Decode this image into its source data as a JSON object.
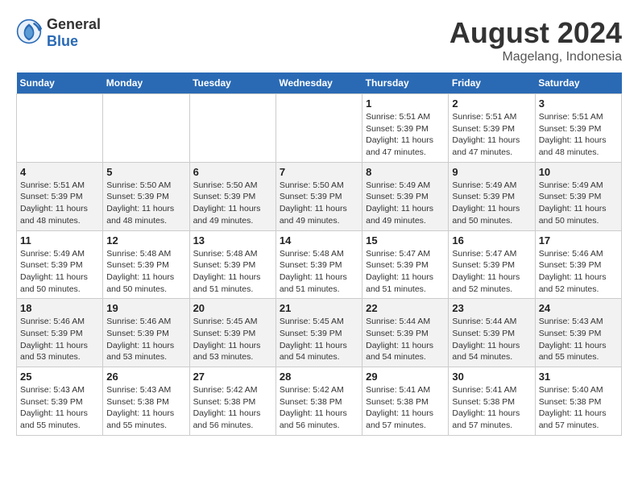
{
  "header": {
    "logo_general": "General",
    "logo_blue": "Blue",
    "month_year": "August 2024",
    "location": "Magelang, Indonesia"
  },
  "days_of_week": [
    "Sunday",
    "Monday",
    "Tuesday",
    "Wednesday",
    "Thursday",
    "Friday",
    "Saturday"
  ],
  "weeks": [
    {
      "days": [
        {
          "num": "",
          "sunrise": "",
          "sunset": "",
          "daylight": ""
        },
        {
          "num": "",
          "sunrise": "",
          "sunset": "",
          "daylight": ""
        },
        {
          "num": "",
          "sunrise": "",
          "sunset": "",
          "daylight": ""
        },
        {
          "num": "",
          "sunrise": "",
          "sunset": "",
          "daylight": ""
        },
        {
          "num": "1",
          "sunrise": "Sunrise: 5:51 AM",
          "sunset": "Sunset: 5:39 PM",
          "daylight": "Daylight: 11 hours and 47 minutes."
        },
        {
          "num": "2",
          "sunrise": "Sunrise: 5:51 AM",
          "sunset": "Sunset: 5:39 PM",
          "daylight": "Daylight: 11 hours and 47 minutes."
        },
        {
          "num": "3",
          "sunrise": "Sunrise: 5:51 AM",
          "sunset": "Sunset: 5:39 PM",
          "daylight": "Daylight: 11 hours and 48 minutes."
        }
      ]
    },
    {
      "days": [
        {
          "num": "4",
          "sunrise": "Sunrise: 5:51 AM",
          "sunset": "Sunset: 5:39 PM",
          "daylight": "Daylight: 11 hours and 48 minutes."
        },
        {
          "num": "5",
          "sunrise": "Sunrise: 5:50 AM",
          "sunset": "Sunset: 5:39 PM",
          "daylight": "Daylight: 11 hours and 48 minutes."
        },
        {
          "num": "6",
          "sunrise": "Sunrise: 5:50 AM",
          "sunset": "Sunset: 5:39 PM",
          "daylight": "Daylight: 11 hours and 49 minutes."
        },
        {
          "num": "7",
          "sunrise": "Sunrise: 5:50 AM",
          "sunset": "Sunset: 5:39 PM",
          "daylight": "Daylight: 11 hours and 49 minutes."
        },
        {
          "num": "8",
          "sunrise": "Sunrise: 5:49 AM",
          "sunset": "Sunset: 5:39 PM",
          "daylight": "Daylight: 11 hours and 49 minutes."
        },
        {
          "num": "9",
          "sunrise": "Sunrise: 5:49 AM",
          "sunset": "Sunset: 5:39 PM",
          "daylight": "Daylight: 11 hours and 50 minutes."
        },
        {
          "num": "10",
          "sunrise": "Sunrise: 5:49 AM",
          "sunset": "Sunset: 5:39 PM",
          "daylight": "Daylight: 11 hours and 50 minutes."
        }
      ]
    },
    {
      "days": [
        {
          "num": "11",
          "sunrise": "Sunrise: 5:49 AM",
          "sunset": "Sunset: 5:39 PM",
          "daylight": "Daylight: 11 hours and 50 minutes."
        },
        {
          "num": "12",
          "sunrise": "Sunrise: 5:48 AM",
          "sunset": "Sunset: 5:39 PM",
          "daylight": "Daylight: 11 hours and 50 minutes."
        },
        {
          "num": "13",
          "sunrise": "Sunrise: 5:48 AM",
          "sunset": "Sunset: 5:39 PM",
          "daylight": "Daylight: 11 hours and 51 minutes."
        },
        {
          "num": "14",
          "sunrise": "Sunrise: 5:48 AM",
          "sunset": "Sunset: 5:39 PM",
          "daylight": "Daylight: 11 hours and 51 minutes."
        },
        {
          "num": "15",
          "sunrise": "Sunrise: 5:47 AM",
          "sunset": "Sunset: 5:39 PM",
          "daylight": "Daylight: 11 hours and 51 minutes."
        },
        {
          "num": "16",
          "sunrise": "Sunrise: 5:47 AM",
          "sunset": "Sunset: 5:39 PM",
          "daylight": "Daylight: 11 hours and 52 minutes."
        },
        {
          "num": "17",
          "sunrise": "Sunrise: 5:46 AM",
          "sunset": "Sunset: 5:39 PM",
          "daylight": "Daylight: 11 hours and 52 minutes."
        }
      ]
    },
    {
      "days": [
        {
          "num": "18",
          "sunrise": "Sunrise: 5:46 AM",
          "sunset": "Sunset: 5:39 PM",
          "daylight": "Daylight: 11 hours and 53 minutes."
        },
        {
          "num": "19",
          "sunrise": "Sunrise: 5:46 AM",
          "sunset": "Sunset: 5:39 PM",
          "daylight": "Daylight: 11 hours and 53 minutes."
        },
        {
          "num": "20",
          "sunrise": "Sunrise: 5:45 AM",
          "sunset": "Sunset: 5:39 PM",
          "daylight": "Daylight: 11 hours and 53 minutes."
        },
        {
          "num": "21",
          "sunrise": "Sunrise: 5:45 AM",
          "sunset": "Sunset: 5:39 PM",
          "daylight": "Daylight: 11 hours and 54 minutes."
        },
        {
          "num": "22",
          "sunrise": "Sunrise: 5:44 AM",
          "sunset": "Sunset: 5:39 PM",
          "daylight": "Daylight: 11 hours and 54 minutes."
        },
        {
          "num": "23",
          "sunrise": "Sunrise: 5:44 AM",
          "sunset": "Sunset: 5:39 PM",
          "daylight": "Daylight: 11 hours and 54 minutes."
        },
        {
          "num": "24",
          "sunrise": "Sunrise: 5:43 AM",
          "sunset": "Sunset: 5:39 PM",
          "daylight": "Daylight: 11 hours and 55 minutes."
        }
      ]
    },
    {
      "days": [
        {
          "num": "25",
          "sunrise": "Sunrise: 5:43 AM",
          "sunset": "Sunset: 5:39 PM",
          "daylight": "Daylight: 11 hours and 55 minutes."
        },
        {
          "num": "26",
          "sunrise": "Sunrise: 5:43 AM",
          "sunset": "Sunset: 5:38 PM",
          "daylight": "Daylight: 11 hours and 55 minutes."
        },
        {
          "num": "27",
          "sunrise": "Sunrise: 5:42 AM",
          "sunset": "Sunset: 5:38 PM",
          "daylight": "Daylight: 11 hours and 56 minutes."
        },
        {
          "num": "28",
          "sunrise": "Sunrise: 5:42 AM",
          "sunset": "Sunset: 5:38 PM",
          "daylight": "Daylight: 11 hours and 56 minutes."
        },
        {
          "num": "29",
          "sunrise": "Sunrise: 5:41 AM",
          "sunset": "Sunset: 5:38 PM",
          "daylight": "Daylight: 11 hours and 57 minutes."
        },
        {
          "num": "30",
          "sunrise": "Sunrise: 5:41 AM",
          "sunset": "Sunset: 5:38 PM",
          "daylight": "Daylight: 11 hours and 57 minutes."
        },
        {
          "num": "31",
          "sunrise": "Sunrise: 5:40 AM",
          "sunset": "Sunset: 5:38 PM",
          "daylight": "Daylight: 11 hours and 57 minutes."
        }
      ]
    }
  ]
}
